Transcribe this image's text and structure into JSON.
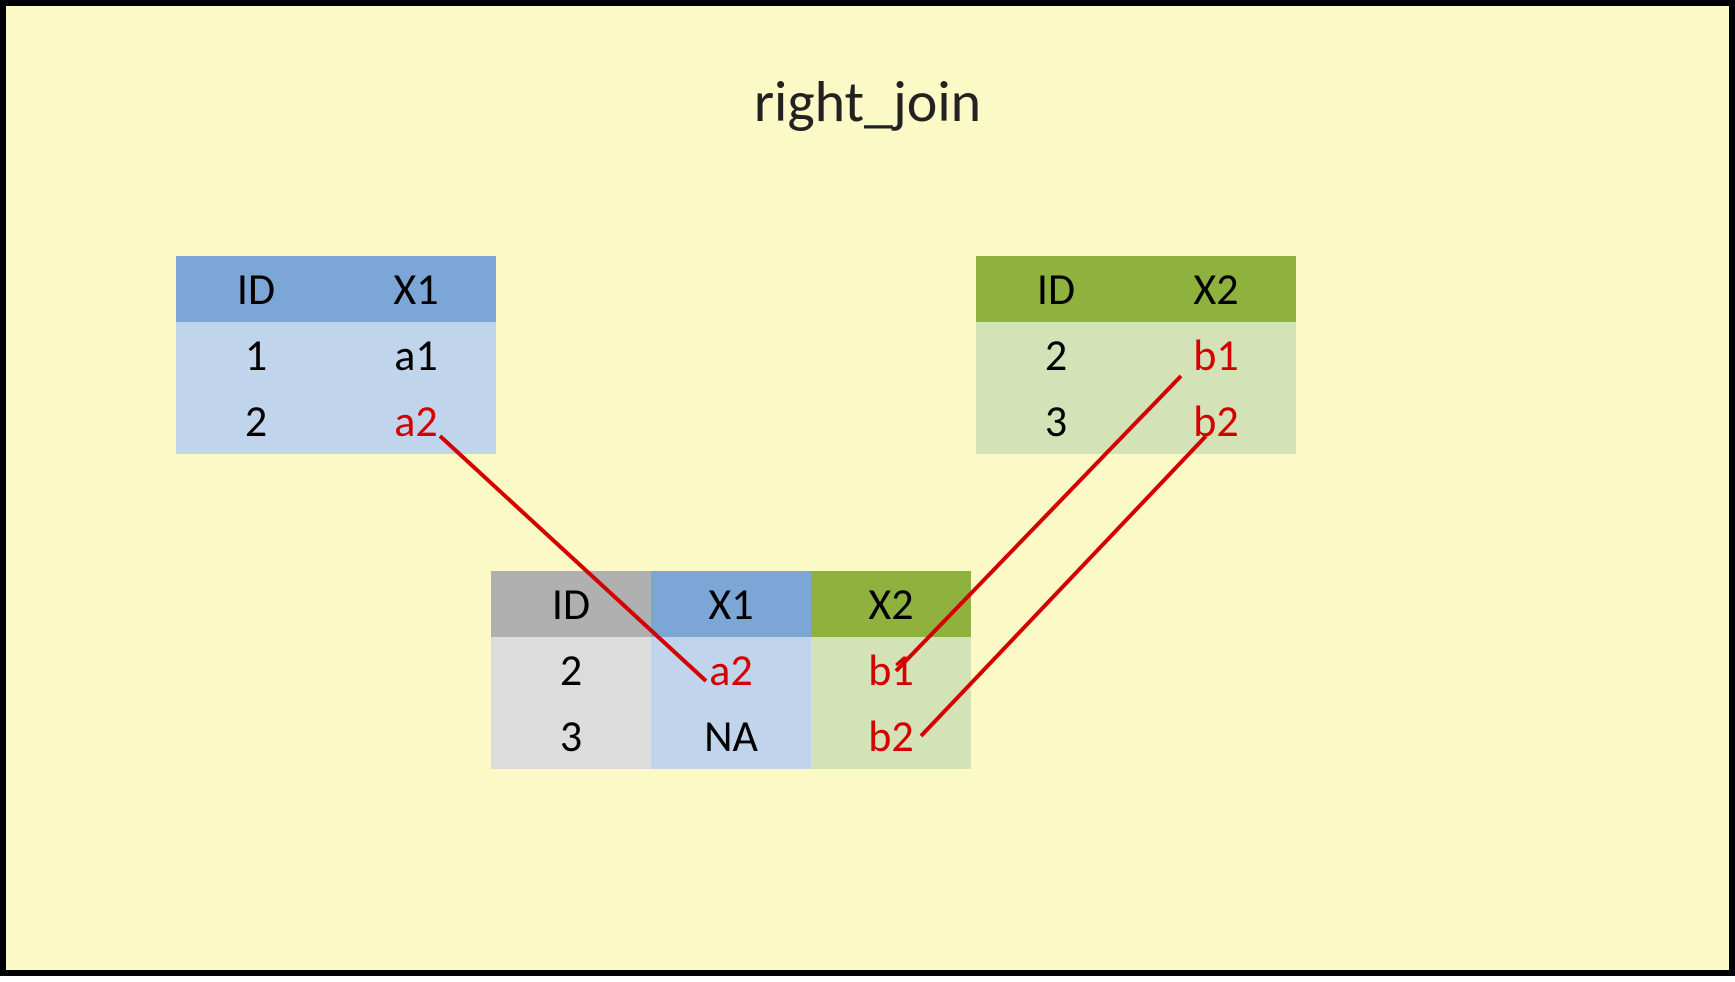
{
  "title": "right_join",
  "tableA": {
    "headers": [
      "ID",
      "X1"
    ],
    "rows": [
      {
        "id": "1",
        "x1": "a1",
        "x1_red": false
      },
      {
        "id": "2",
        "x1": "a2",
        "x1_red": true
      }
    ]
  },
  "tableB": {
    "headers": [
      "ID",
      "X2"
    ],
    "rows": [
      {
        "id": "2",
        "x2": "b1",
        "x2_red": true
      },
      {
        "id": "3",
        "x2": "b2",
        "x2_red": true
      }
    ]
  },
  "tableR": {
    "headers": [
      "ID",
      "X1",
      "X2"
    ],
    "rows": [
      {
        "id": "2",
        "x1": "a2",
        "x1_red": true,
        "x2": "b1",
        "x2_red": true
      },
      {
        "id": "3",
        "x1": "NA",
        "x1_red": false,
        "x2": "b2",
        "x2_red": true
      }
    ]
  },
  "colors": {
    "background": "#fbfac6",
    "blue_header": "#7ba6d6",
    "blue_body": "#c0d5ec",
    "green_header": "#8fb23f",
    "green_body": "#d4e2b8",
    "grey_header": "#b0b0b0",
    "grey_body": "#dcdcdc",
    "highlight": "#d40000"
  }
}
